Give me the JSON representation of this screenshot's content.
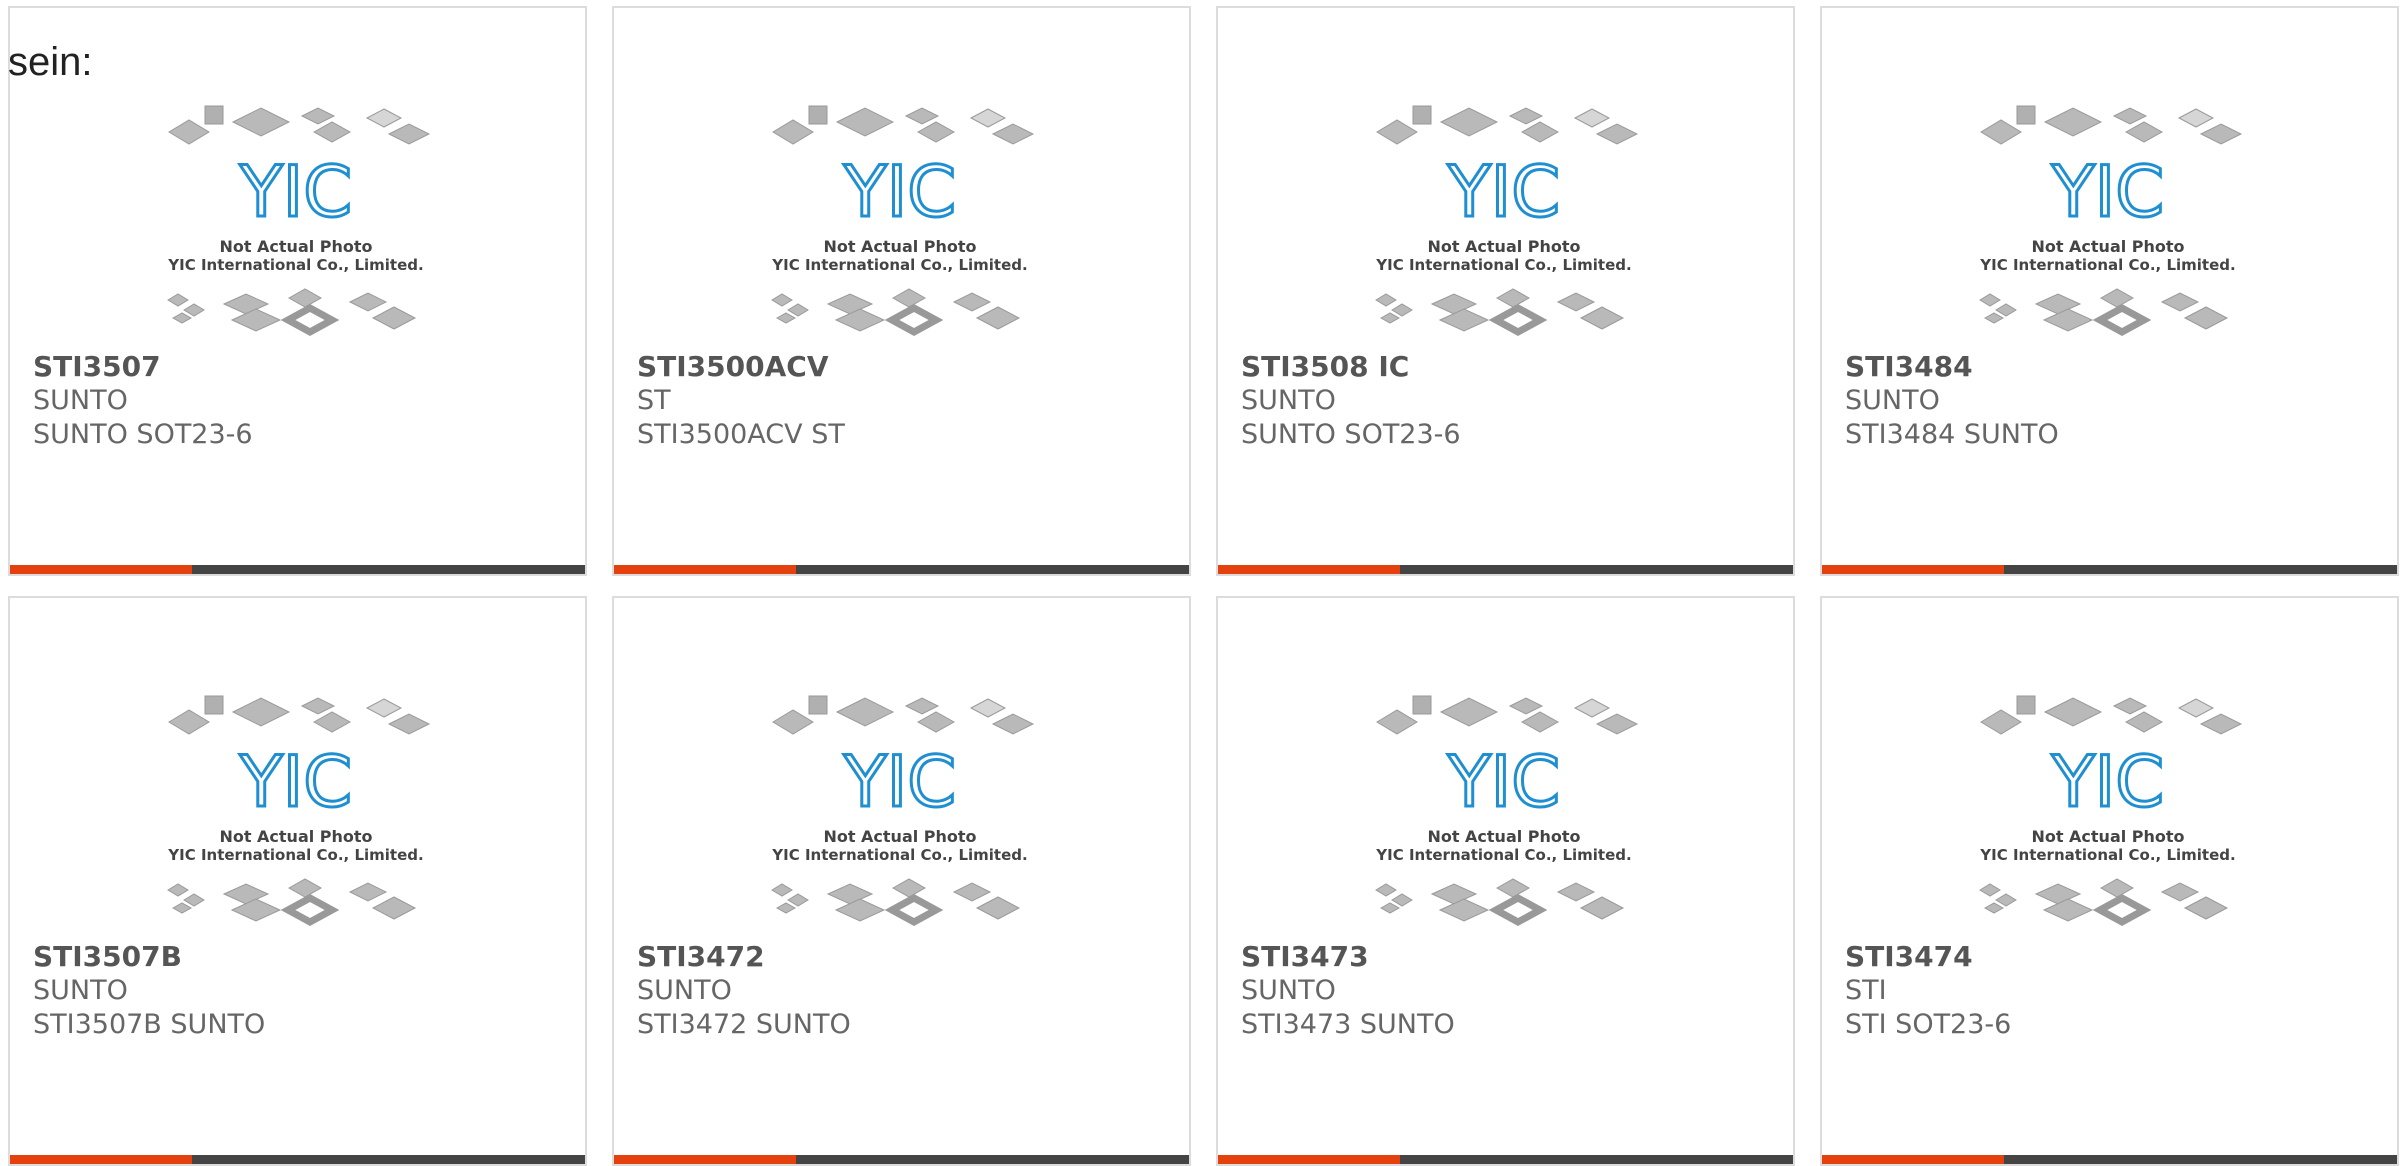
{
  "page": {
    "intro_text": "sein:"
  },
  "placeholder": {
    "caption_line1": "Not Actual Photo",
    "caption_line2": "YIC International Co., Limited.",
    "logo_text": "YIC"
  },
  "colors": {
    "accent": "#e5410f",
    "bar": "#444444",
    "logo": "#1f8fd1"
  },
  "products": [
    {
      "part": "STI3507",
      "manufacturer": "SUNTO",
      "description": "SUNTO SOT23-6"
    },
    {
      "part": "STI3500ACV",
      "manufacturer": "ST",
      "description": "STI3500ACV ST"
    },
    {
      "part": "STI3508 IC",
      "manufacturer": "SUNTO",
      "description": "SUNTO SOT23-6"
    },
    {
      "part": "STI3484",
      "manufacturer": "SUNTO",
      "description": "STI3484 SUNTO"
    },
    {
      "part": "STI3507B",
      "manufacturer": "SUNTO",
      "description": "STI3507B SUNTO"
    },
    {
      "part": "STI3472",
      "manufacturer": "SUNTO",
      "description": "STI3472 SUNTO"
    },
    {
      "part": "STI3473",
      "manufacturer": "SUNTO",
      "description": "STI3473 SUNTO"
    },
    {
      "part": "STI3474",
      "manufacturer": "STI",
      "description": "STI SOT23-6"
    }
  ]
}
